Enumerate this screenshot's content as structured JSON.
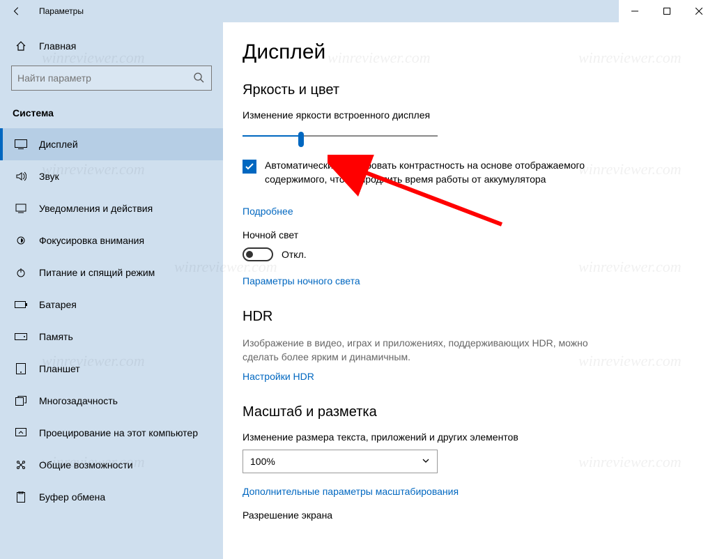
{
  "window": {
    "title": "Параметры"
  },
  "sidebar": {
    "home_label": "Главная",
    "search_placeholder": "Найти параметр",
    "group_title": "Система",
    "items": [
      {
        "label": "Дисплей"
      },
      {
        "label": "Звук"
      },
      {
        "label": "Уведомления и действия"
      },
      {
        "label": "Фокусировка внимания"
      },
      {
        "label": "Питание и спящий режим"
      },
      {
        "label": "Батарея"
      },
      {
        "label": "Память"
      },
      {
        "label": "Планшет"
      },
      {
        "label": "Многозадачность"
      },
      {
        "label": "Проецирование на этот компьютер"
      },
      {
        "label": "Общие возможности"
      },
      {
        "label": "Буфер обмена"
      }
    ]
  },
  "main": {
    "page_title": "Дисплей",
    "brightness": {
      "heading": "Яркость и цвет",
      "slider_label": "Изменение яркости встроенного дисплея",
      "slider_percent": 30,
      "checkbox_text": "Автоматически регулировать контрастность на основе отображаемого содержимого, чтобы продлить время работы от аккумулятора",
      "more_link": "Подробнее",
      "night_light_label": "Ночной свет",
      "night_light_state": "Откл.",
      "night_light_settings_link": "Параметры ночного света"
    },
    "hdr": {
      "heading": "HDR",
      "desc": "Изображение в видео, играх и приложениях, поддерживающих HDR, можно сделать более ярким и динамичным.",
      "settings_link": "Настройки HDR"
    },
    "scale": {
      "heading": "Масштаб и разметка",
      "scale_label": "Изменение размера текста, приложений и других элементов",
      "scale_value": "100%",
      "advanced_link": "Дополнительные параметры масштабирования",
      "resolution_label": "Разрешение экрана"
    }
  },
  "watermark_text": "winreviewer.com"
}
